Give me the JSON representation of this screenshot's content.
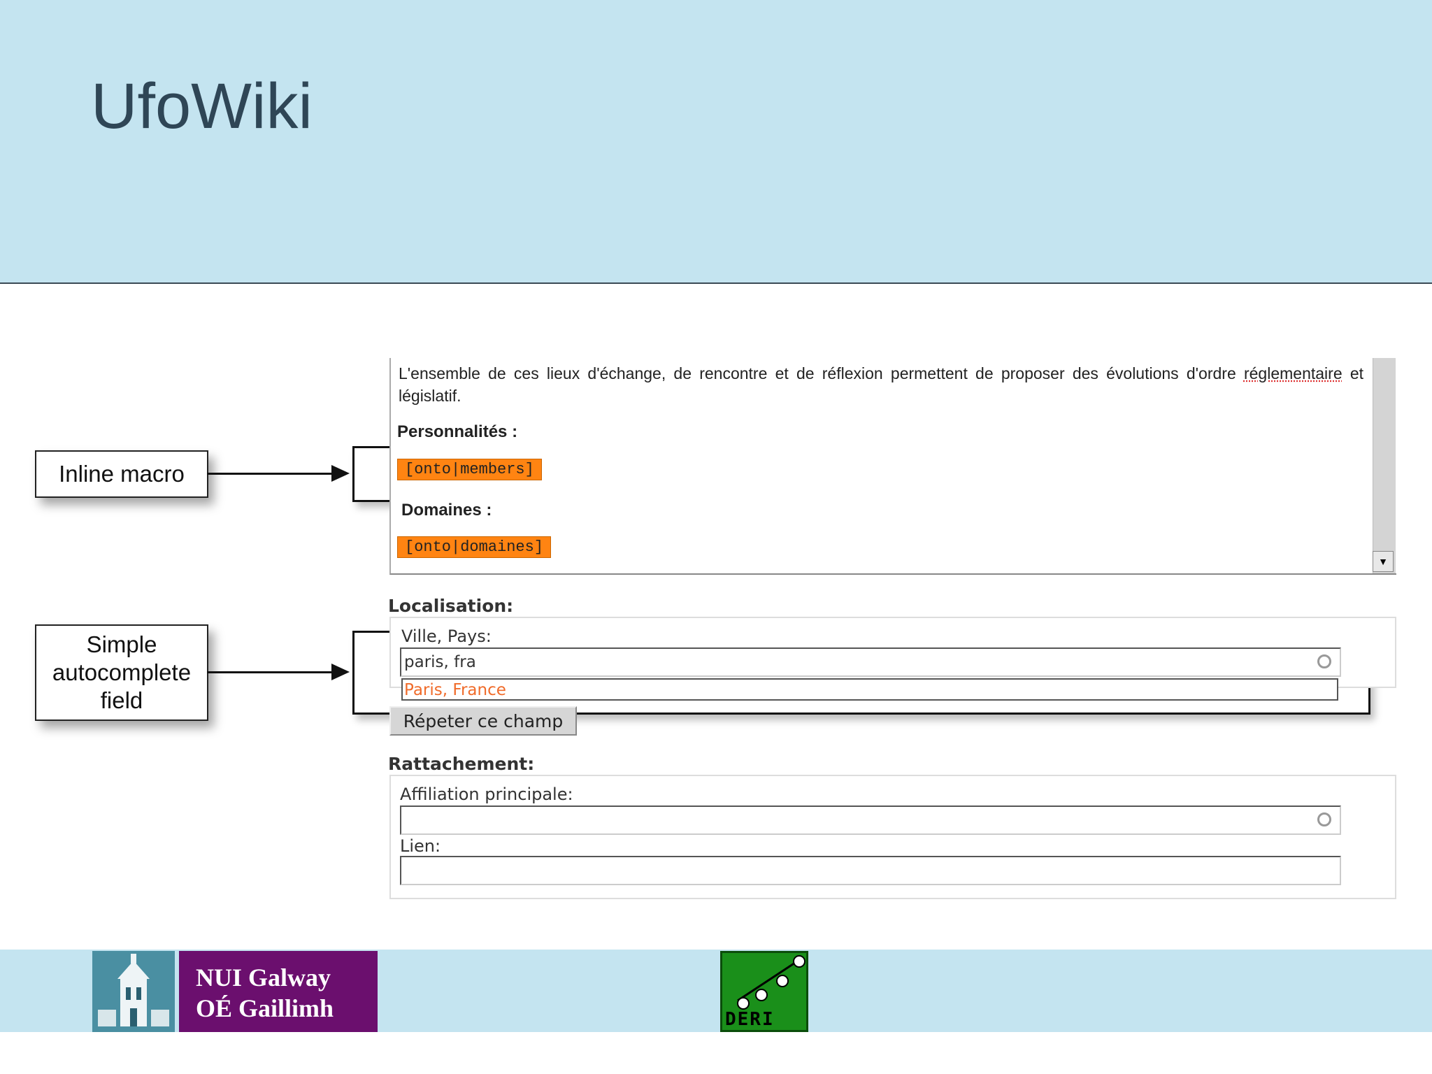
{
  "slide": {
    "title": "UfoWiki"
  },
  "callouts": {
    "inline_macro": "Inline macro",
    "autocomplete": "Simple autocomplete field"
  },
  "editor": {
    "paragraph_part1": "L'ensemble de ces lieux d'échange, de rencontre et de réflexion permettent de proposer des évolutions d'ordre",
    "paragraph_misspelled": "réglementaire",
    "paragraph_part2": " et législatif.",
    "personnalites_label": "Personnalités :",
    "macro_members": "[onto|members]",
    "domaines_label": "Domaines :",
    "macro_domaines": "[onto|domaines]"
  },
  "localisation": {
    "title": "Localisation:",
    "field_label": "Ville, Pays:",
    "input_value": "paris, fra",
    "suggestion": "Paris, France",
    "repeat_button": "Répeter ce champ"
  },
  "rattachement": {
    "title": "Rattachement:",
    "affiliation_label": "Affiliation principale:",
    "affiliation_value": "",
    "lien_label": "Lien:",
    "lien_value": ""
  },
  "footer": {
    "nui_line1": "NUI Galway",
    "nui_line2": "OÉ Gaillimh",
    "deri": "DERI"
  },
  "colors": {
    "band": "#c4e4f0",
    "macro": "#ff8412",
    "suggestion": "#f06b2a",
    "nui": "#6b0f6e",
    "deri": "#1a8f1a"
  }
}
